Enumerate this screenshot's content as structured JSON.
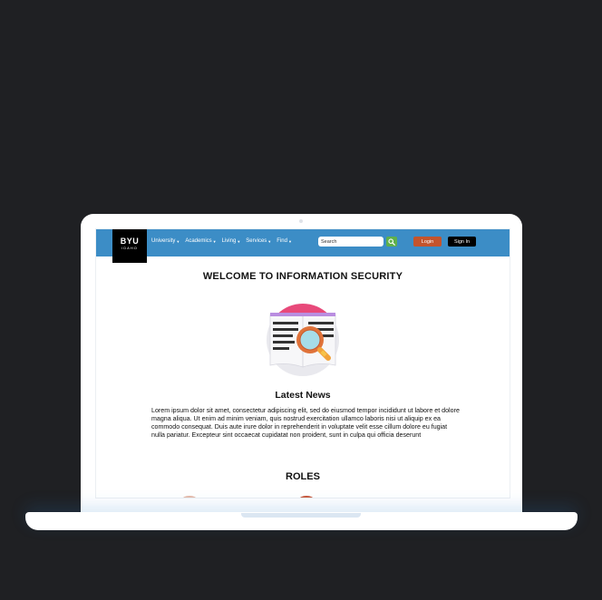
{
  "nav": {
    "logo_main": "BYU",
    "logo_sub": "IDAHO",
    "items": [
      {
        "label": "University"
      },
      {
        "label": "Academics"
      },
      {
        "label": "Living"
      },
      {
        "label": "Services"
      },
      {
        "label": "Find"
      }
    ],
    "search_placeholder": "Search",
    "login_label": "Login",
    "signin_label": "Sign In"
  },
  "main": {
    "title": "WELCOME TO INFORMATION SECURITY",
    "hero_icon": "document-magnifier-icon",
    "news_title": "Latest News",
    "news_body": "Lorem ipsum dolor sit amet, consectetur adipiscing elit, sed do eiusmod tempor incididunt ut labore et dolore magna aliqua. Ut enim ad minim veniam, quis nostrud exercitation ullamco laboris nisi ut aliquip ex ea commodo consequat. Duis aute irure dolor in reprehenderit in voluptate velit esse cillum dolore eu fugiat nulla pariatur. Excepteur sint occaecat cupidatat non proident, sunt in culpa qui officia deserunt",
    "roles_title": "ROLES"
  },
  "colors": {
    "nav_bg": "#3c8dc6",
    "login_bg": "#c4542c",
    "signin_bg": "#000000",
    "search_btn_bg": "#5fb04b",
    "page_bg": "#1f2023"
  }
}
